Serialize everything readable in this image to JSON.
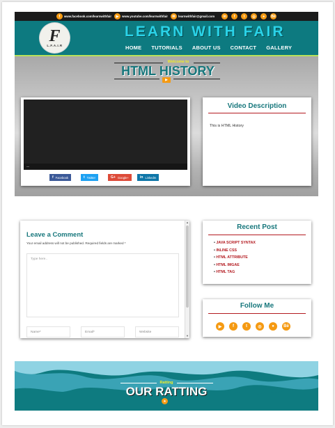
{
  "topbar": {
    "facebook": "www.facebook.com/learnwithfair",
    "youtube": "www.youtube.com/learnwithfair",
    "email": "learnwithfair@gmail.com",
    "social_icons": [
      "linkedin-icon",
      "facebook-icon",
      "twitter-icon",
      "instagram-icon",
      "github-icon",
      "behance-icon"
    ]
  },
  "header": {
    "logo_letter": "F",
    "logo_text": "L.F.A.I.R",
    "title": "LEARN WITH FAIR",
    "nav": [
      "HOME",
      "TUTORIALS",
      "ABOUT US",
      "CONTACT",
      "GALLERY"
    ]
  },
  "hero": {
    "welcome": "Welcome to",
    "title": "HTML HISTORY"
  },
  "share_buttons": [
    {
      "label": "Facebook",
      "icon": "f",
      "color": "#3b5998"
    },
    {
      "label": "Twitter",
      "icon": "t",
      "color": "#1da1f2"
    },
    {
      "label": "Google+",
      "icon": "G+",
      "color": "#dd4b39"
    },
    {
      "label": "LinkedIn",
      "icon": "in",
      "color": "#0e76a8"
    }
  ],
  "description": {
    "heading": "Video Description",
    "text": "This is HTML History"
  },
  "comment": {
    "title": "Leave a Comment",
    "note": "Your email address will not be published. Required fields are marked *",
    "placeholder": "Type here..",
    "name_placeholder": "Name*",
    "email_placeholder": "Email*",
    "website_placeholder": "Website"
  },
  "recent": {
    "heading": "Recent Post",
    "items": [
      "JAVA SCRIPT SYNTAX",
      "INLINE CSS",
      "HTML ATTRIBUTE",
      "HTML IMGAE",
      "HTML TAG"
    ]
  },
  "follow": {
    "heading": "Follow Me",
    "icons": [
      "youtube-icon",
      "facebook-icon",
      "twitter-icon",
      "instagram-icon",
      "github-icon",
      "behance-icon"
    ]
  },
  "footer": {
    "label": "Ratting",
    "title": "OUR RATTING"
  },
  "colors": {
    "teal": "#0d7a80",
    "orange": "#f59a12",
    "red": "#b3191f",
    "yellow": "#f1ee28"
  }
}
